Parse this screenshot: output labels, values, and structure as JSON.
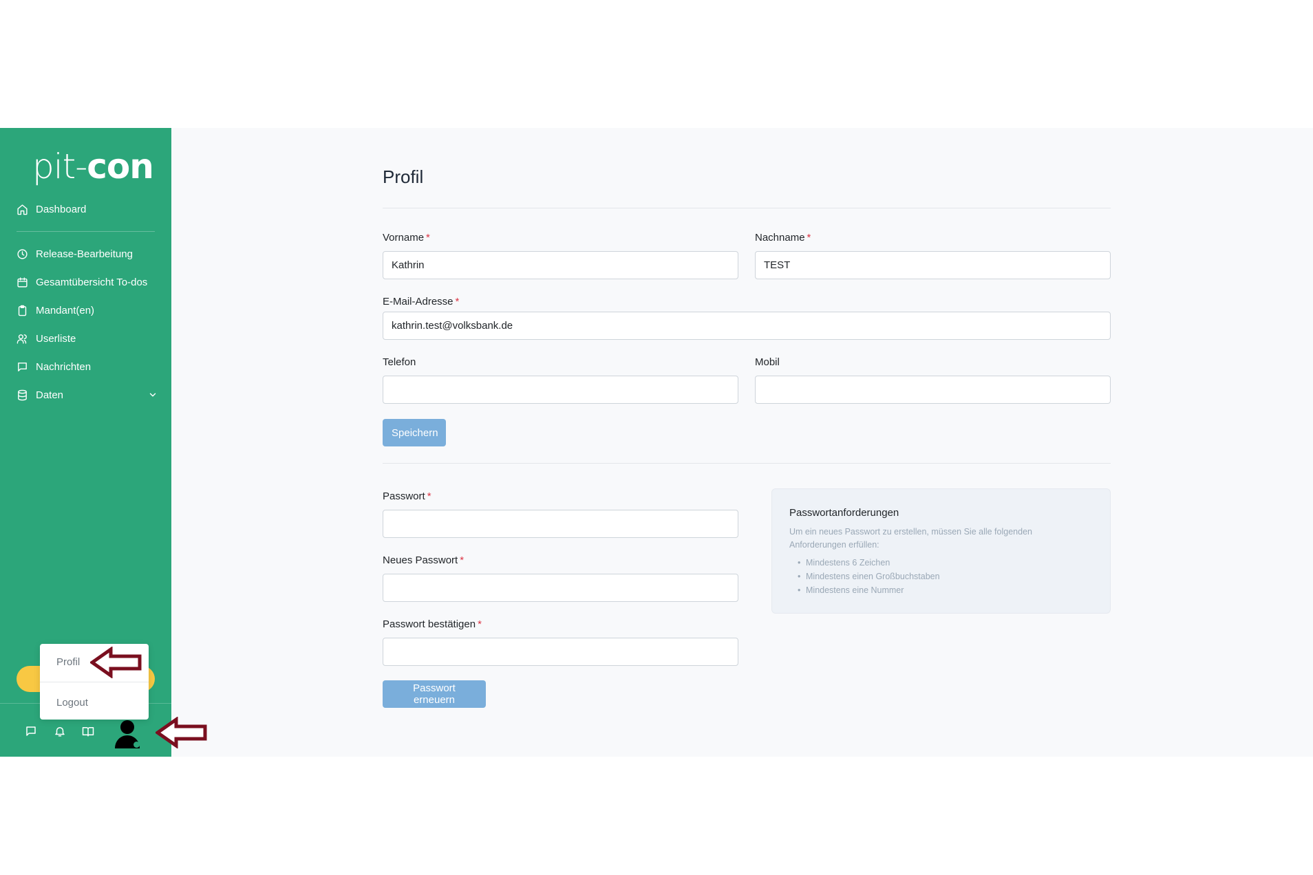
{
  "sidebar": {
    "logo_light": "pit-",
    "logo_bold": "con",
    "items": [
      {
        "label": "Dashboard",
        "icon": "home-icon"
      },
      {
        "label": "Release-Bearbeitung",
        "icon": "clock-icon"
      },
      {
        "label": "Gesamtübersicht To-dos",
        "icon": "calendar-icon"
      },
      {
        "label": "Mandant(en)",
        "icon": "clipboard-icon"
      },
      {
        "label": "Userliste",
        "icon": "users-icon"
      },
      {
        "label": "Nachrichten",
        "icon": "message-icon"
      },
      {
        "label": "Daten",
        "icon": "database-icon"
      }
    ],
    "footer_icons": [
      "message-icon",
      "bell-icon",
      "book-icon",
      "user-avatar-icon"
    ]
  },
  "user_menu": {
    "profile_label": "Profil",
    "logout_label": "Logout"
  },
  "main": {
    "title": "Profil",
    "profile_form": {
      "first_name_label": "Vorname",
      "first_name_value": "Kathrin",
      "last_name_label": "Nachname",
      "last_name_value": "TEST",
      "email_label": "E-Mail-Adresse",
      "email_value": "kathrin.test@volksbank.de",
      "phone_label": "Telefon",
      "phone_value": "",
      "mobile_label": "Mobil",
      "mobile_value": "",
      "required_mark": "*",
      "save_label": "Speichern"
    },
    "password_form": {
      "password_label": "Passwort",
      "new_password_label": "Neues Passwort",
      "confirm_password_label": "Passwort bestätigen",
      "required_mark": "*",
      "submit_label": "Passwort erneuern"
    },
    "requirements": {
      "title": "Passwortanforderungen",
      "description": "Um ein neues Passwort zu erstellen, müssen Sie alle folgenden Anforderungen erfüllen:",
      "items": [
        "Mindestens 6 Zeichen",
        "Mindestens einen Großbuchstaben",
        "Mindestens eine Nummer"
      ]
    }
  },
  "colors": {
    "sidebar": "#2ca67a",
    "accent_yellow": "#f8c843",
    "button": "#7aaedb",
    "annotation_arrow": "#7a0f1f",
    "required": "#dc3545"
  }
}
